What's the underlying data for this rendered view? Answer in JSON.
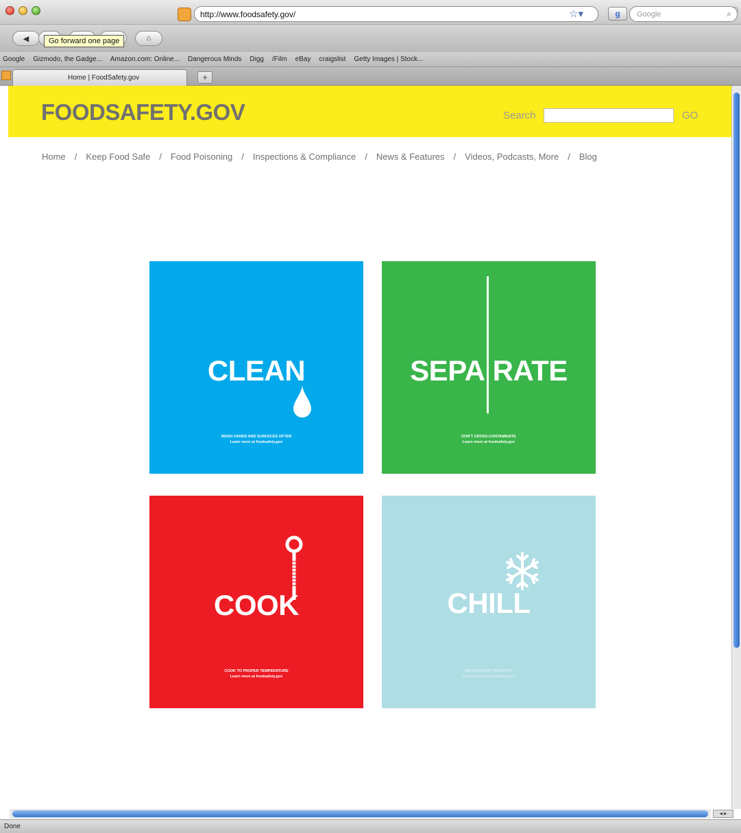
{
  "window": {
    "title": "Home | FoodSafety.gov"
  },
  "toolbar": {
    "tooltip": "Go forward one page",
    "url": "http://www.foodsafety.gov/",
    "search_placeholder": "Google"
  },
  "bookmarks": [
    "Google",
    "Gizmodo, the Gadge...",
    "Amazon.com: Online...",
    "Dangerous Minds",
    "Digg",
    "/Film",
    "eBay",
    "craigslist",
    "Getty Images | Stock..."
  ],
  "tab": {
    "label": "Home | FoodSafety.gov",
    "new_tab": "+"
  },
  "site": {
    "logo": "FOODSAFETY.GOV",
    "search_label": "Search",
    "go_label": "GO"
  },
  "nav": {
    "separator": "/",
    "items": [
      "Home",
      "Keep Food Safe",
      "Food Poisoning",
      "Inspections & Compliance",
      "News & Features",
      "Videos, Podcasts, More",
      "Blog"
    ]
  },
  "tiles": {
    "clean": {
      "word": "CLEAN",
      "caption": "WASH HANDS AND SURFACES OFTEN",
      "learn": "Learn more at foodsafety.gov",
      "color": "#03a9ea"
    },
    "separate": {
      "word_left": "SEPA",
      "word_right": "RATE",
      "caption": "DON'T CROSS-CONTAMINATE",
      "learn": "Learn more at foodsafety.gov",
      "color": "#39b54a"
    },
    "cook": {
      "word": "COOK",
      "caption": "COOK TO PROPER TEMPERATURE",
      "learn": "Learn more at foodsafety.gov",
      "color": "#ed1c24"
    },
    "chill": {
      "word": "CHILL",
      "caption": "REFRIGERATE PROMPTLY",
      "learn": "Learn more at foodsafety.gov",
      "color": "#aedde4"
    }
  },
  "status": {
    "text": "Done"
  }
}
